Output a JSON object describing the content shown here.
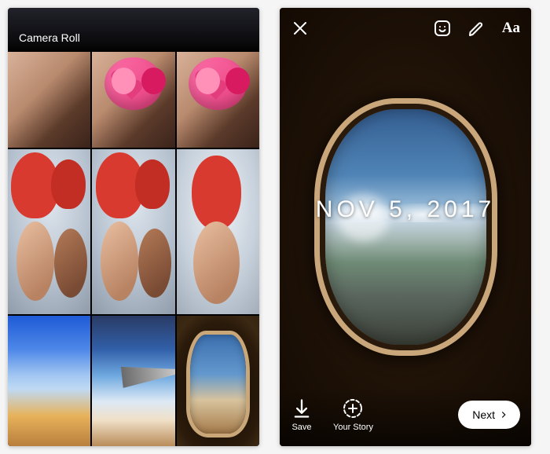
{
  "left": {
    "header_label": "Camera Roll"
  },
  "right": {
    "date_stamp": "NOV 5, 2017",
    "save_label": "Save",
    "your_story_label": "Your Story",
    "next_label": "Next",
    "text_tool_label": "Aa"
  }
}
